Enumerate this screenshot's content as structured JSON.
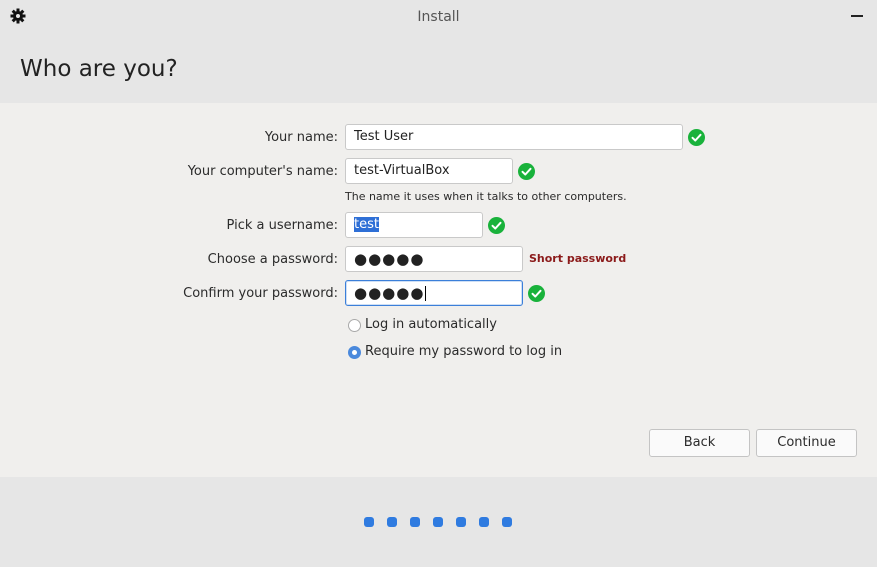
{
  "window": {
    "title": "Install"
  },
  "page": {
    "heading": "Who are you?"
  },
  "form": {
    "name": {
      "label": "Your name:",
      "value": "Test User",
      "valid": true
    },
    "computer": {
      "label": "Your computer's name:",
      "value": "test-VirtualBox",
      "valid": true,
      "hint": "The name it uses when it talks to other computers."
    },
    "username": {
      "label": "Pick a username:",
      "value": "test",
      "valid": true
    },
    "password": {
      "label": "Choose a password:",
      "value": "●●●●●",
      "warning": "Short password"
    },
    "confirm": {
      "label": "Confirm your password:",
      "value": "●●●●●",
      "valid": true
    },
    "login_options": [
      {
        "label": "Log in automatically",
        "selected": false
      },
      {
        "label": "Require my password to log in",
        "selected": true
      }
    ]
  },
  "buttons": {
    "back": "Back",
    "continue": "Continue"
  },
  "progress": {
    "steps": 7
  },
  "colors": {
    "accent": "#2f7be0",
    "valid": "#19b23b",
    "warning": "#8b1a1a"
  },
  "icons": {
    "settings": "gear-icon",
    "minimize": "minimize-icon",
    "valid": "checkmark-icon"
  }
}
